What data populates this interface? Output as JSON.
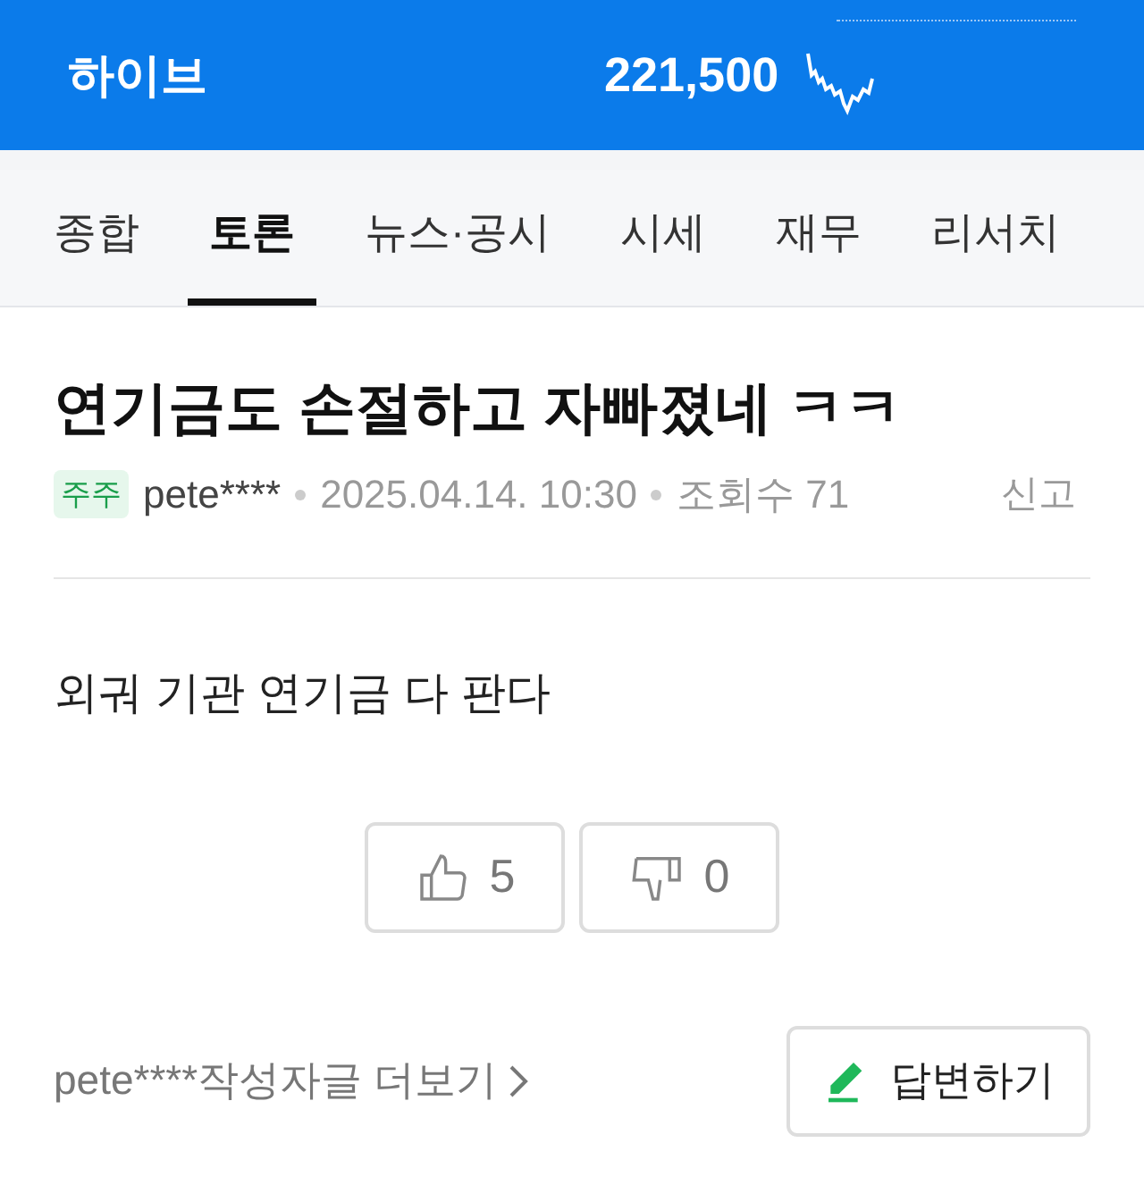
{
  "header": {
    "stock_name": "하이브",
    "price": "221,500"
  },
  "tabs": [
    {
      "label": "종합",
      "selected": false
    },
    {
      "label": "토론",
      "selected": true
    },
    {
      "label": "뉴스·공시",
      "selected": false
    },
    {
      "label": "시세",
      "selected": false
    },
    {
      "label": "재무",
      "selected": false
    },
    {
      "label": "리서치",
      "selected": false
    }
  ],
  "post": {
    "title": "연기금도 손절하고 자빠졌네 ㅋㅋ",
    "badge": "주주",
    "author": "pete****",
    "date": "2025.04.14. 10:30",
    "views": "조회수 71",
    "report": "신고",
    "body": "외궈 기관 연기금 다 판다",
    "likes": "5",
    "dislikes": "0"
  },
  "footer": {
    "more_link": "pete****작성자글 더보기",
    "reply_button": "답변하기"
  }
}
